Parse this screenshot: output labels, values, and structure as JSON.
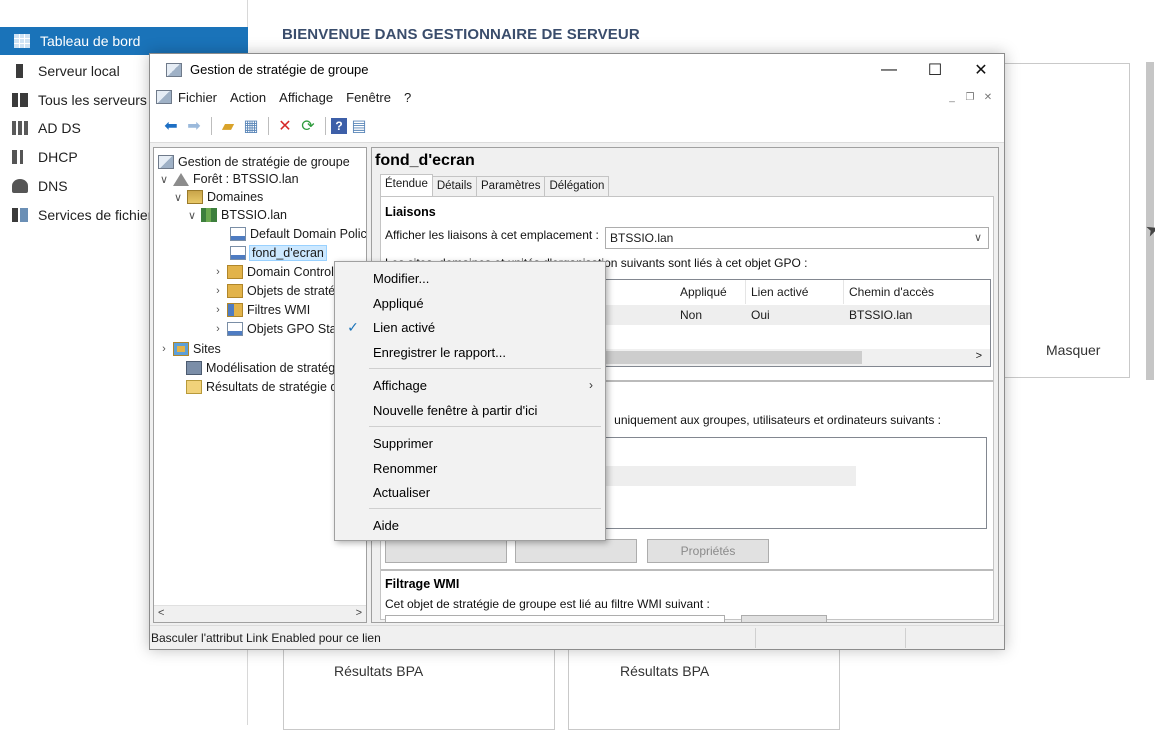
{
  "server_manager": {
    "sidebar": [
      {
        "label": "Tableau de bord",
        "icon": "dashboard-icon"
      },
      {
        "label": "Serveur local",
        "icon": "server-icon"
      },
      {
        "label": "Tous les serveurs",
        "icon": "servers-icon"
      },
      {
        "label": "AD DS",
        "icon": "ad-ds-icon"
      },
      {
        "label": "DHCP",
        "icon": "dhcp-icon"
      },
      {
        "label": "DNS",
        "icon": "dns-icon"
      },
      {
        "label": "Services de fichiers et de stockage",
        "icon": "file-services-icon"
      }
    ],
    "header": "BIENVENUE DANS GESTIONNAIRE DE SERVEUR",
    "hide_label": "Masquer",
    "bpa_label_1": "Résultats BPA",
    "bpa_label_2": "Résultats BPA",
    "accent_color": "#1a73b9"
  },
  "gpmc": {
    "title": "Gestion de stratégie de groupe",
    "title_buttons": {
      "minimize": "—",
      "maximize": "☐",
      "close": "✕"
    },
    "menu": [
      "Fichier",
      "Action",
      "Affichage",
      "Fenêtre",
      "?"
    ],
    "toolbar_icons": [
      "back-icon",
      "forward-icon",
      "up-folder-icon",
      "show-hide-tree-icon",
      "delete-icon",
      "refresh-icon",
      "help-icon",
      "properties-icon"
    ],
    "tree": {
      "root": "Gestion de stratégie de groupe",
      "forest": "Forêt : BTSSIO.lan",
      "domains": "Domaines",
      "domain": "BTSSIO.lan",
      "children": [
        "Default Domain Policy",
        "fond_d'ecran",
        "Domain Controllers",
        "Objets de stratégie de groupe",
        "Filtres WMI",
        "Objets GPO Starter"
      ],
      "sites": "Sites",
      "modeling": "Modélisation de stratégie de groupe",
      "results": "Résultats de stratégie de groupe"
    },
    "right": {
      "gpo_name": "fond_d'ecran",
      "tabs": [
        "Étendue",
        "Détails",
        "Paramètres",
        "Délégation"
      ],
      "links_title": "Liaisons",
      "links_label": "Afficher les liaisons à cet emplacement :",
      "links_value": "BTSSIO.lan",
      "links_info": "Les sites, domaines et unités d'organisation suivants sont liés à cet objet GPO :",
      "columns": [
        "Appliqué",
        "Lien activé",
        "Chemin d'accès"
      ],
      "row": {
        "applied": "Non",
        "enabled": "Oui",
        "path": "BTSSIO.lan"
      },
      "filter_info": "uniquement aux groupes, utilisateurs et ordinateurs suivants :",
      "properties_button": "Propriétés",
      "wmi_title": "Filtrage WMI",
      "wmi_info": "Cet objet de stratégie de groupe est lié au filtre WMI suivant :"
    },
    "status": "Basculer l'attribut Link Enabled pour ce lien"
  },
  "context_menu": [
    {
      "label": "Modifier...",
      "checked": false
    },
    {
      "label": "Appliqué",
      "checked": false
    },
    {
      "label": "Lien activé",
      "checked": true
    },
    {
      "label": "Enregistrer le rapport...",
      "checked": false
    },
    {
      "label": "Affichage",
      "submenu": true
    },
    {
      "label": "Nouvelle fenêtre à partir d'ici"
    },
    {
      "label": "Supprimer"
    },
    {
      "label": "Renommer"
    },
    {
      "label": "Actualiser"
    },
    {
      "label": "Aide"
    }
  ]
}
